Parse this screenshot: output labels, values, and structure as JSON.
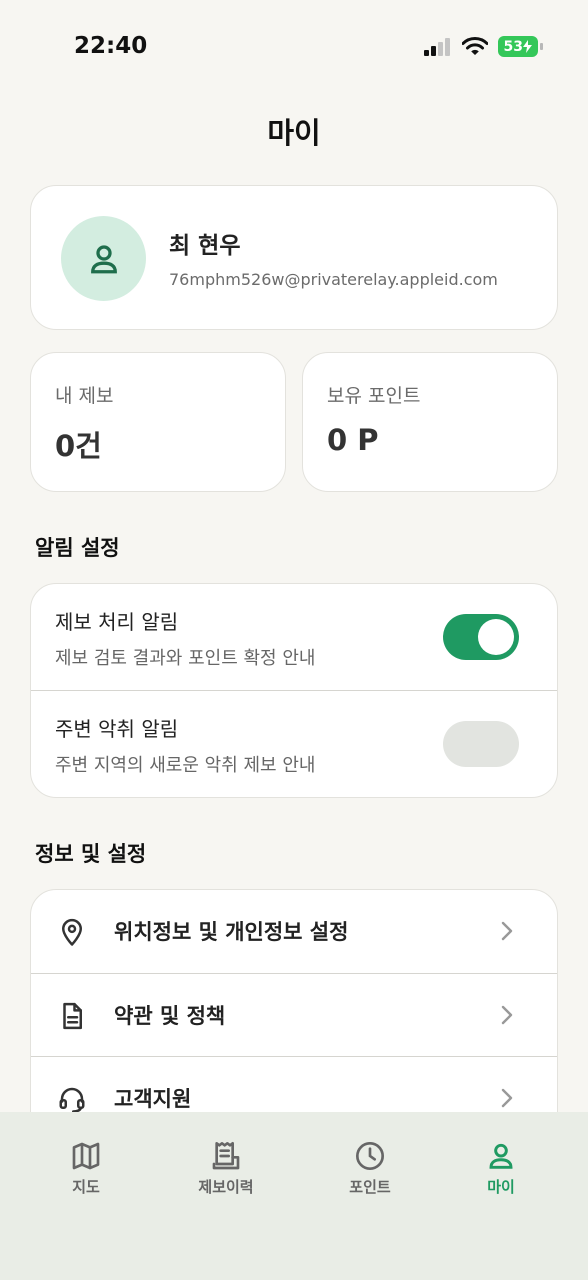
{
  "status_bar": {
    "time": "22:40",
    "battery": "53"
  },
  "page": {
    "title": "마이"
  },
  "profile": {
    "name": "최 현우",
    "email": "76mphm526w@privaterelay.appleid.com"
  },
  "stats": [
    {
      "label": "내 제보",
      "value": "0건"
    },
    {
      "label": "보유 포인트",
      "value": "0 P"
    }
  ],
  "notifications": {
    "section_title": "알림 설정",
    "items": [
      {
        "title": "제보 처리 알림",
        "description": "제보 검토 결과와 포인트 확정 안내",
        "enabled": true
      },
      {
        "title": "주변 악취 알림",
        "description": "주변 지역의 새로운 악취 제보 안내",
        "enabled": false
      }
    ]
  },
  "info": {
    "section_title": "정보 및 설정",
    "items": [
      {
        "label": "위치정보 및 개인정보 설정",
        "icon": "location-pin-icon"
      },
      {
        "label": "약관 및 정책",
        "icon": "document-icon"
      },
      {
        "label": "고객지원",
        "icon": "headset-icon"
      }
    ]
  },
  "tab_bar": {
    "items": [
      {
        "label": "지도",
        "icon": "map-icon",
        "active": false
      },
      {
        "label": "제보이력",
        "icon": "receipt-icon",
        "active": false
      },
      {
        "label": "포인트",
        "icon": "clock-icon",
        "active": false
      },
      {
        "label": "마이",
        "icon": "person-icon",
        "active": true
      }
    ]
  },
  "colors": {
    "accent": "#1f9a62",
    "avatar_bg": "#d3ede0",
    "background": "#f7f6f2",
    "tab_bar_bg": "#e9ede6"
  }
}
